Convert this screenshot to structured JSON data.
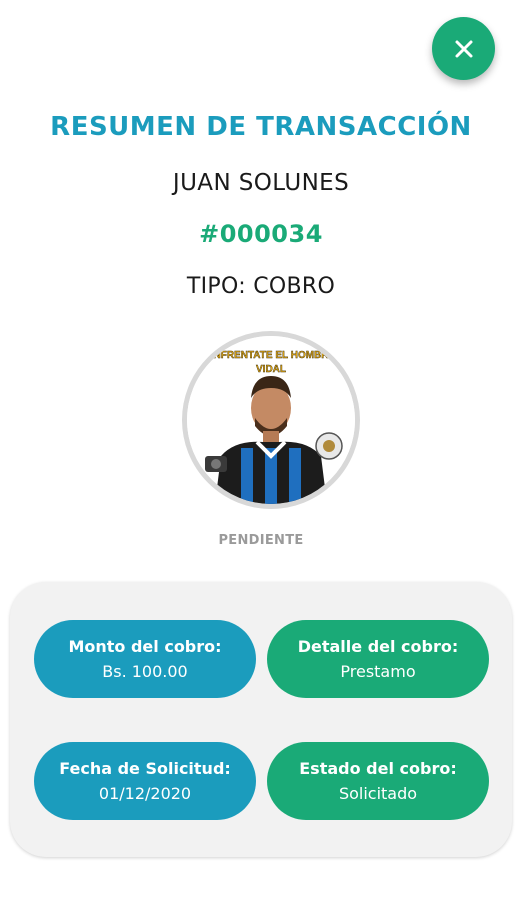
{
  "header": {
    "close_icon": "close-icon",
    "title": "RESUMEN DE TRANSACCIÓN",
    "name": "JUAN SOLUNES",
    "code": "#000034",
    "type": "TIPO: COBRO"
  },
  "avatar": {
    "banner_line1": "ENFRENTATE EL HOMBRE",
    "banner_line2": "VIDAL"
  },
  "status": "PENDIENTE",
  "details": [
    {
      "label": "Monto del cobro:",
      "value": "Bs. 100.00",
      "color": "#1b9cbd"
    },
    {
      "label": "Detalle del cobro:",
      "value": "Prestamo",
      "color": "#1aaa77"
    },
    {
      "label": "Fecha de Solicitud:",
      "value": "01/12/2020",
      "color": "#1b9cbd"
    },
    {
      "label": "Estado del cobro:",
      "value": "Solicitado",
      "color": "#1aaa77"
    }
  ],
  "colors": {
    "accent_blue": "#1b9cbd",
    "accent_green": "#1aaa77"
  }
}
